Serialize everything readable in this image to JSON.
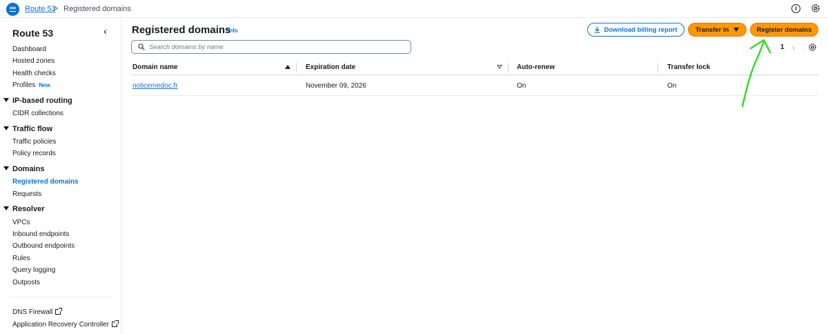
{
  "breadcrumb": {
    "root": "Route 53",
    "separator": ">",
    "current": "Registered domains"
  },
  "sidebar": {
    "title": "Route 53",
    "collapse_glyph": "‹",
    "top_items": [
      "Dashboard",
      "Hosted zones",
      "Health checks"
    ],
    "profiles": {
      "label": "Profiles",
      "badge": "New"
    },
    "sections": [
      {
        "title": "IP-based routing",
        "items": [
          "CIDR collections"
        ]
      },
      {
        "title": "Traffic flow",
        "items": [
          "Traffic policies",
          "Policy records"
        ]
      },
      {
        "title": "Domains",
        "items": [
          "Registered domains",
          "Requests"
        ]
      },
      {
        "title": "Resolver",
        "items": [
          "VPCs",
          "Inbound endpoints",
          "Outbound endpoints",
          "Rules",
          "Query logging",
          "Outposts"
        ]
      }
    ],
    "active_item": "Registered domains",
    "external_links": [
      "DNS Firewall",
      "Application Recovery Controller"
    ]
  },
  "main": {
    "title": "Registered domains",
    "info_label": "Info",
    "buttons": {
      "download": "Download billing report",
      "transfer": "Transfer in",
      "register": "Register domains"
    },
    "search": {
      "placeholder": "Search domains by name",
      "value": ""
    },
    "pagination": {
      "prev": "‹",
      "page": "1",
      "next": "›"
    },
    "table": {
      "columns": [
        "Domain name",
        "Expiration date",
        "Auto-renew",
        "Transfer lock"
      ],
      "rows": [
        {
          "domain": "noticemedoc.fr",
          "expiration": "November 09, 2026",
          "auto_renew": "On",
          "transfer_lock": "On"
        }
      ]
    }
  },
  "colors": {
    "accent": "#0972d3",
    "primary_button": "#ff9900",
    "annotation": "#2ee01f"
  },
  "icons": [
    "menu-icon",
    "info-icon",
    "settings-icon",
    "download-icon",
    "search-icon",
    "external-link-icon",
    "arrow-annotation"
  ]
}
